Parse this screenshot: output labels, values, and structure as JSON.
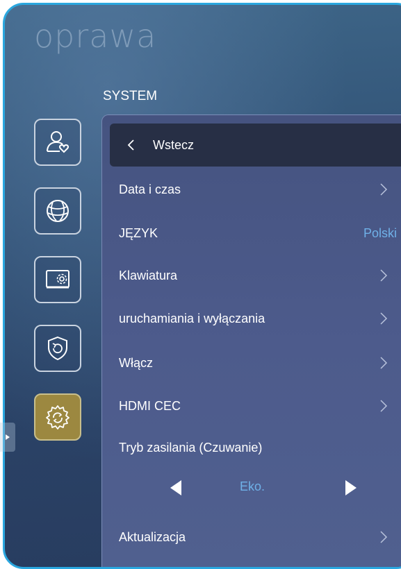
{
  "app_title": "oprawa",
  "section_title": "SYSTEM",
  "sidebar": {
    "items": [
      {
        "name": "account",
        "icon": "user-heart-icon"
      },
      {
        "name": "network",
        "icon": "globe-icon"
      },
      {
        "name": "display-settings",
        "icon": "monitor-gear-icon"
      },
      {
        "name": "security",
        "icon": "shield-refresh-icon"
      },
      {
        "name": "system",
        "icon": "gear-refresh-icon",
        "active": true
      }
    ],
    "active_color": "#9c8840"
  },
  "panel": {
    "back_label": "Wstecz",
    "rows": [
      {
        "label": "Data i czas"
      },
      {
        "label": "JĘZYK",
        "value": "Polski"
      },
      {
        "label": "Klawiatura"
      },
      {
        "label": "uruchamiania i wyłączania"
      },
      {
        "label": "Włącz"
      },
      {
        "label": "HDMI CEC"
      },
      {
        "label": "Tryb zasilania (Czuwanie)"
      }
    ],
    "power_mode_value": "Eko.",
    "update_label": "Aktualizacja"
  },
  "colors": {
    "accent_blue": "#6fb1e8",
    "frame_border": "#2aa7df"
  }
}
